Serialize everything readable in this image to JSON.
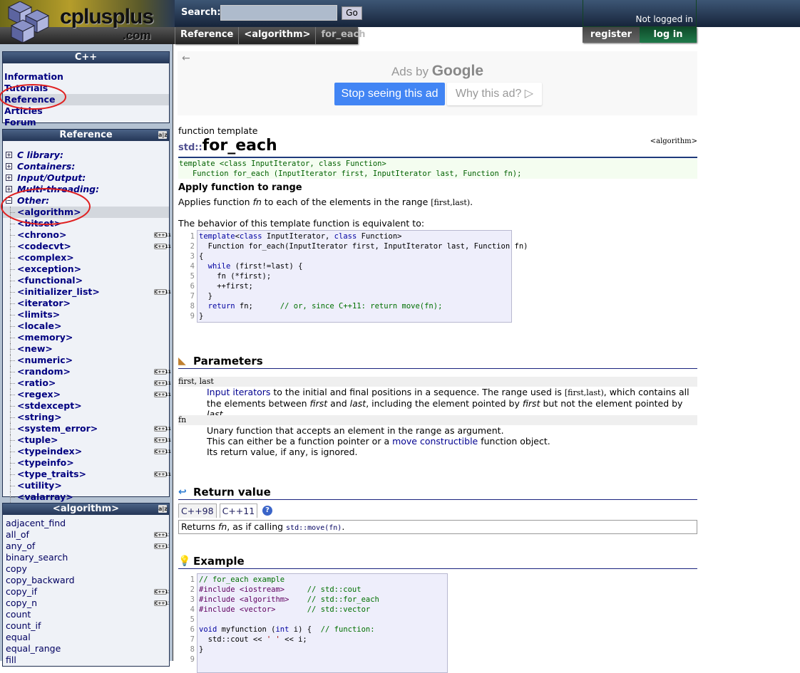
{
  "header": {
    "logo_text": "cplusplus",
    "logo_domain": ".com",
    "search_label": "Search:",
    "search_value": "",
    "go_label": "Go",
    "breadcrumb": [
      "Reference",
      "<algorithm>",
      "for_each"
    ],
    "login_status": "Not logged in",
    "register_label": "register",
    "login_label": "log in"
  },
  "sidebar": {
    "cpp_box": {
      "title": "C++",
      "items": [
        "Information",
        "Tutorials",
        "Reference",
        "Articles",
        "Forum"
      ],
      "selected": "Reference"
    },
    "reference_box": {
      "title": "Reference",
      "sort_icon": "az-sort-icon",
      "categories": [
        {
          "label": "C library:",
          "expanded": false
        },
        {
          "label": "Containers:",
          "expanded": false
        },
        {
          "label": "Input/Output:",
          "expanded": false
        },
        {
          "label": "Multi-threading:",
          "expanded": false
        },
        {
          "label": "Other:",
          "expanded": true
        }
      ],
      "other_items": [
        {
          "label": "<algorithm>",
          "cpp11": false,
          "selected": true
        },
        {
          "label": "<bitset>",
          "cpp11": false
        },
        {
          "label": "<chrono>",
          "cpp11": true
        },
        {
          "label": "<codecvt>",
          "cpp11": true
        },
        {
          "label": "<complex>",
          "cpp11": false
        },
        {
          "label": "<exception>",
          "cpp11": false
        },
        {
          "label": "<functional>",
          "cpp11": false
        },
        {
          "label": "<initializer_list>",
          "cpp11": true
        },
        {
          "label": "<iterator>",
          "cpp11": false
        },
        {
          "label": "<limits>",
          "cpp11": false
        },
        {
          "label": "<locale>",
          "cpp11": false
        },
        {
          "label": "<memory>",
          "cpp11": false
        },
        {
          "label": "<new>",
          "cpp11": false
        },
        {
          "label": "<numeric>",
          "cpp11": false
        },
        {
          "label": "<random>",
          "cpp11": true
        },
        {
          "label": "<ratio>",
          "cpp11": true
        },
        {
          "label": "<regex>",
          "cpp11": true
        },
        {
          "label": "<stdexcept>",
          "cpp11": false
        },
        {
          "label": "<string>",
          "cpp11": false
        },
        {
          "label": "<system_error>",
          "cpp11": true
        },
        {
          "label": "<tuple>",
          "cpp11": true
        },
        {
          "label": "<typeindex>",
          "cpp11": true
        },
        {
          "label": "<typeinfo>",
          "cpp11": false
        },
        {
          "label": "<type_traits>",
          "cpp11": true
        },
        {
          "label": "<utility>",
          "cpp11": false
        },
        {
          "label": "<valarray>",
          "cpp11": false
        }
      ]
    },
    "algorithm_box": {
      "title": "<algorithm>",
      "items": [
        {
          "label": "adjacent_find",
          "cpp11": false
        },
        {
          "label": "all_of",
          "cpp11": true
        },
        {
          "label": "any_of",
          "cpp11": true
        },
        {
          "label": "binary_search",
          "cpp11": false
        },
        {
          "label": "copy",
          "cpp11": false
        },
        {
          "label": "copy_backward",
          "cpp11": false
        },
        {
          "label": "copy_if",
          "cpp11": true
        },
        {
          "label": "copy_n",
          "cpp11": true
        },
        {
          "label": "count",
          "cpp11": false
        },
        {
          "label": "count_if",
          "cpp11": false
        },
        {
          "label": "equal",
          "cpp11": false
        },
        {
          "label": "equal_range",
          "cpp11": false
        },
        {
          "label": "fill",
          "cpp11": false
        }
      ]
    },
    "cpp11_badge": "C++11"
  },
  "ad": {
    "back": "←",
    "ads_by": "Ads by",
    "google": "Google",
    "stop_label": "Stop seeing this ad",
    "why_label": "Why this ad? ▷"
  },
  "main": {
    "kind": "function template",
    "namespace": "std::",
    "name": "for_each",
    "header": "<algorithm>",
    "prototype": "template <class InputIterator, class Function>\n   Function for_each (InputIterator first, InputIterator last, Function fn);",
    "subtitle": "Apply function to range",
    "desc_pre": "Applies function ",
    "desc_fn": "fn",
    "desc_mid": " to each of the elements in the range ",
    "desc_range": "[first,last)",
    "desc_end": ".",
    "equiv_text": "The behavior of this template function is equivalent to:",
    "equiv_code": [
      [
        [
          "kw",
          "template"
        ],
        [
          "",
          "<"
        ],
        [
          "kw",
          "class"
        ],
        [
          "",
          " InputIterator, "
        ],
        [
          "kw",
          "class"
        ],
        [
          "",
          " Function>"
        ]
      ],
      [
        [
          "",
          "  Function for_each(InputIterator first, InputIterator last, Function fn)"
        ]
      ],
      [
        [
          "",
          "{"
        ]
      ],
      [
        [
          "",
          "  "
        ],
        [
          "kw",
          "while"
        ],
        [
          "",
          " (first!=last) {"
        ]
      ],
      [
        [
          "",
          "    fn (*first);"
        ]
      ],
      [
        [
          "",
          "    ++first;"
        ]
      ],
      [
        [
          "",
          "  }"
        ]
      ],
      [
        [
          "",
          "  "
        ],
        [
          "kw",
          "return"
        ],
        [
          "",
          " fn;      "
        ],
        [
          "cm",
          "// or, since C++11: return move(fn);"
        ]
      ],
      [
        [
          "",
          "}"
        ]
      ]
    ],
    "parameters": {
      "title": "Parameters",
      "items": [
        {
          "name": "first, last",
          "lines": [
            "Input iterators to the initial and final positions in a sequence. The range used is [first,last), which contains all",
            "the elements between first and last, including the element pointed by first but not the element pointed by last."
          ]
        },
        {
          "name": "fn",
          "lines": [
            "Unary function that accepts an element in the range as argument.",
            "This can either be a function pointer or a move constructible function object.",
            "Its return value, if any, is ignored."
          ]
        }
      ]
    },
    "return_value": {
      "title": "Return value",
      "tabs": [
        "C++98",
        "C++11"
      ],
      "active_tab": "C++11",
      "help": "?",
      "text_pre": "Returns ",
      "text_fn": "fn",
      "text_mid": ", as if calling ",
      "text_code": "std::move(fn)",
      "text_end": "."
    },
    "example": {
      "title": "Example",
      "code": [
        [
          [
            "cm",
            "// for_each example"
          ]
        ],
        [
          [
            "pp",
            "#include <iostream>"
          ],
          [
            "",
            "     "
          ],
          [
            "cm",
            "// std::cout"
          ]
        ],
        [
          [
            "pp",
            "#include <algorithm>"
          ],
          [
            "",
            "    "
          ],
          [
            "cm",
            "// std::for_each"
          ]
        ],
        [
          [
            "pp",
            "#include <vector>"
          ],
          [
            "",
            "       "
          ],
          [
            "cm",
            "// std::vector"
          ]
        ],
        [
          [
            "",
            ""
          ]
        ],
        [
          [
            "kw",
            "void"
          ],
          [
            "",
            " myfunction ("
          ],
          [
            "kw",
            "int"
          ],
          [
            "",
            " i) {  "
          ],
          [
            "cm",
            "// function:"
          ]
        ],
        [
          [
            "",
            "  std::cout << "
          ],
          [
            "st",
            "' '"
          ],
          [
            "",
            " << i;"
          ]
        ],
        [
          [
            "",
            "}"
          ]
        ],
        [
          [
            "",
            ""
          ]
        ]
      ]
    }
  },
  "colors": {
    "header_dark": "#16243a",
    "link": "#000080",
    "section_rule": "#1a237e",
    "ad_button": "#4285f4",
    "login_green": "#1f7a4a",
    "annotation_red": "#e02020"
  }
}
